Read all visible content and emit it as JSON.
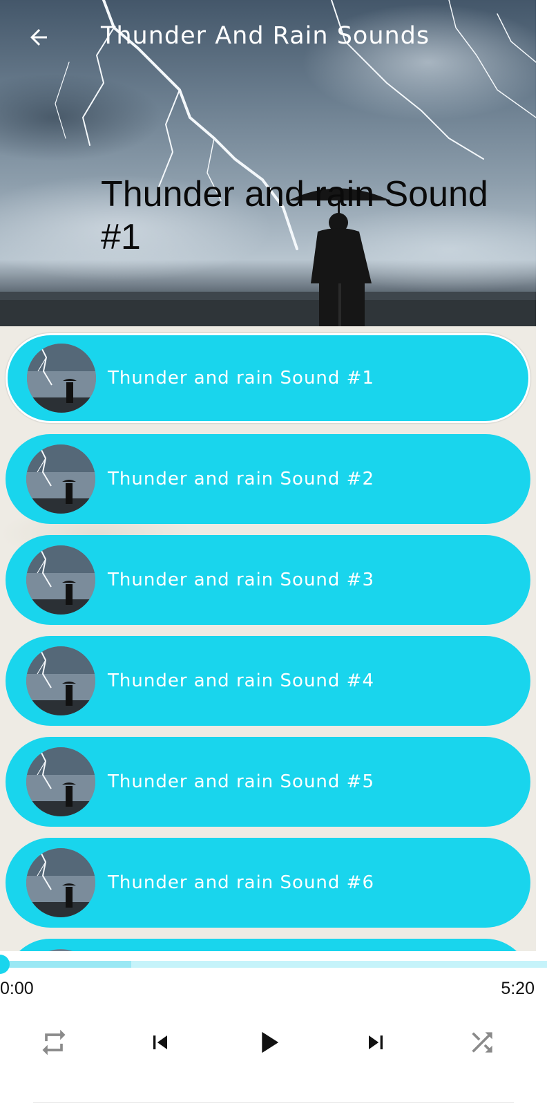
{
  "toolbar": {
    "title": "Thunder And Rain Sounds",
    "back_icon": "arrow-back-icon"
  },
  "hero": {
    "title": "Thunder and rain Sound #1"
  },
  "tracks": [
    {
      "label": "Thunder and rain Sound #1",
      "selected": true
    },
    {
      "label": "Thunder and rain Sound #2",
      "selected": false
    },
    {
      "label": "Thunder and rain Sound #3",
      "selected": false
    },
    {
      "label": "Thunder and rain Sound #4",
      "selected": false
    },
    {
      "label": "Thunder and rain Sound #5",
      "selected": false
    },
    {
      "label": "Thunder and rain Sound #6",
      "selected": false
    },
    {
      "label": "",
      "selected": false
    }
  ],
  "player": {
    "current_time": "0:00",
    "total_time": "5:20",
    "progress": 0.0,
    "buffered": 0.24,
    "controls": [
      "repeat-icon",
      "skip-previous-icon",
      "play-icon",
      "skip-next-icon",
      "shuffle-icon"
    ]
  },
  "colors": {
    "accent": "#19d5ed",
    "seek_track": "#c6f3fa",
    "list_background": "#eeebe4"
  }
}
